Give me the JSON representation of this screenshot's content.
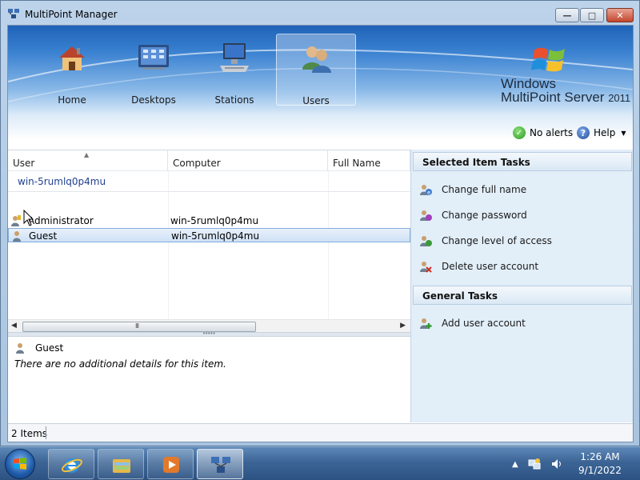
{
  "window": {
    "title": "MultiPoint Manager",
    "controls": {
      "minimize": "—",
      "maximize": "□",
      "close": "✕"
    }
  },
  "nav": {
    "items": [
      {
        "label": "Home",
        "icon": "home-icon"
      },
      {
        "label": "Desktops",
        "icon": "desktops-icon"
      },
      {
        "label": "Stations",
        "icon": "stations-icon"
      },
      {
        "label": "Users",
        "icon": "users-icon",
        "active": true
      }
    ]
  },
  "brand": {
    "line1": "Windows",
    "line2": "MultiPoint",
    "line2b": "Server",
    "version": "2011"
  },
  "header_actions": {
    "alerts": "No alerts",
    "help": "Help"
  },
  "list": {
    "columns": [
      "User",
      "Computer",
      "Full Name"
    ],
    "group": "win-5rumlq0p4mu",
    "rows": [
      {
        "user": "Administrator",
        "computer": "win-5rumlq0p4mu",
        "full_name": "",
        "icon": "admin-user-icon"
      },
      {
        "user": "Guest",
        "computer": "win-5rumlq0p4mu",
        "full_name": "",
        "icon": "user-icon",
        "selected": true
      }
    ]
  },
  "details": {
    "name": "Guest",
    "message": "There are no additional details for this item."
  },
  "tasks": {
    "selected_header": "Selected Item Tasks",
    "selected": [
      {
        "label": "Change full name",
        "icon": "change-name-icon"
      },
      {
        "label": "Change password",
        "icon": "change-password-icon"
      },
      {
        "label": "Change level of access",
        "icon": "access-level-icon"
      },
      {
        "label": "Delete user account",
        "icon": "delete-user-icon"
      }
    ],
    "general_header": "General Tasks",
    "general": [
      {
        "label": "Add user account",
        "icon": "add-user-icon"
      }
    ]
  },
  "statusbar": {
    "count": "2 Items"
  },
  "taskbar": {
    "time": "1:26 AM",
    "date": "9/1/2022",
    "apps": [
      "internet-explorer-icon",
      "explorer-folder-icon",
      "media-player-icon",
      "multipoint-manager-icon"
    ]
  },
  "colors": {
    "accent": "#1f63b8",
    "task_pane": "#e2eef8",
    "selection": "#cfe0f5",
    "group_text": "#1f3f8f"
  }
}
